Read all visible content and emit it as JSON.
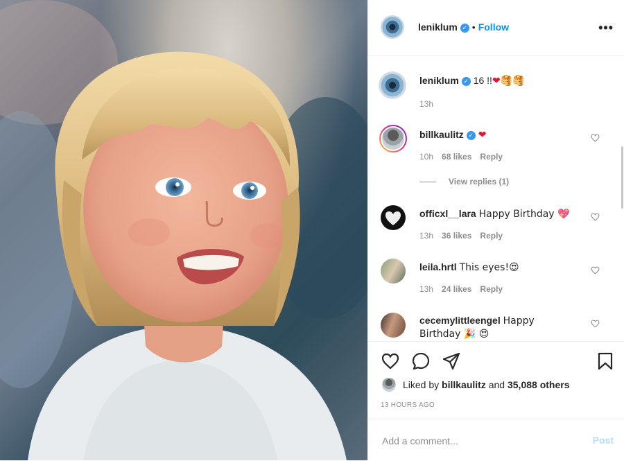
{
  "header": {
    "username": "leniklum",
    "separator": "•",
    "follow_label": "Follow",
    "more_icon": "more-horizontal-icon"
  },
  "caption": {
    "username": "leniklum",
    "text": "16 !!",
    "emojis": "❤🥞🥞",
    "time": "13h"
  },
  "comments": [
    {
      "username": "billkaulitz",
      "verified": true,
      "text": "❤",
      "time": "10h",
      "likes": "68 likes",
      "reply": "Reply"
    },
    {
      "username": "officxl__lara",
      "verified": false,
      "text": "Happy Birthday 💖",
      "time": "13h",
      "likes": "36 likes",
      "reply": "Reply"
    },
    {
      "username": "leila.hrtl",
      "verified": false,
      "text": "This eyes!😍",
      "time": "13h",
      "likes": "24 likes",
      "reply": "Reply"
    },
    {
      "username": "cecemylittleengel",
      "verified": false,
      "text": "Happy Birthday 🎉 😍",
      "time": "",
      "likes": "",
      "reply": ""
    }
  ],
  "view_replies": "View replies (1)",
  "likes": {
    "prefix": "Liked by ",
    "user": "billkaulitz",
    "middle": " and ",
    "others": "35,088 others"
  },
  "timestamp": "13 HOURS AGO",
  "add_comment": {
    "placeholder": "Add a comment...",
    "post_label": "Post"
  },
  "colors": {
    "accent": "#0095f6",
    "verified": "#3897f0",
    "heart_red": "#e0152f",
    "muted": "#8e8e8e"
  }
}
